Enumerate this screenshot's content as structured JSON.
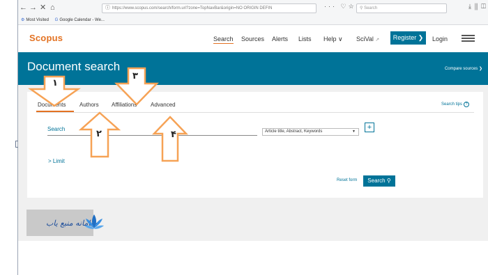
{
  "browser": {
    "back": "←",
    "forward": "→",
    "stop": "✕",
    "home": "⌂",
    "url": "https://www.scopus.com/search/form.uri?zone=TopNavBar&origin=NO ORIGIN DEFIN",
    "url_menu": "···",
    "search_placeholder": "Search",
    "bookmarks": [
      "Most Visited",
      "Google Calendar - We..."
    ]
  },
  "header": {
    "logo": "Scopus",
    "nav": [
      "Search",
      "Sources",
      "Alerts",
      "Lists",
      "Help",
      "SciVal"
    ],
    "help_chevron": "∨",
    "scival_mark": "↗",
    "register": "Register ❯",
    "login": "Login"
  },
  "banner": {
    "title": "Document search",
    "compare": "Compare sources ❯"
  },
  "tabs": [
    "Documents",
    "Authors",
    "Affiliations",
    "Advanced"
  ],
  "search_tips": "Search tips",
  "search_tips_icon": "?",
  "form": {
    "search_label": "Search",
    "field_select": "Article title, Abstract, Keywords",
    "add_field": "+",
    "limit": "> Limit",
    "reset": "Reset form",
    "search_button": "Search ⚲"
  },
  "annotations": [
    "۱",
    "۲",
    "۳",
    "۴"
  ],
  "watermark": {
    "text": "سامانه منبع یاب"
  },
  "colors": {
    "accent": "#e37222",
    "primary": "#007398",
    "arrow": "#f6a255"
  }
}
